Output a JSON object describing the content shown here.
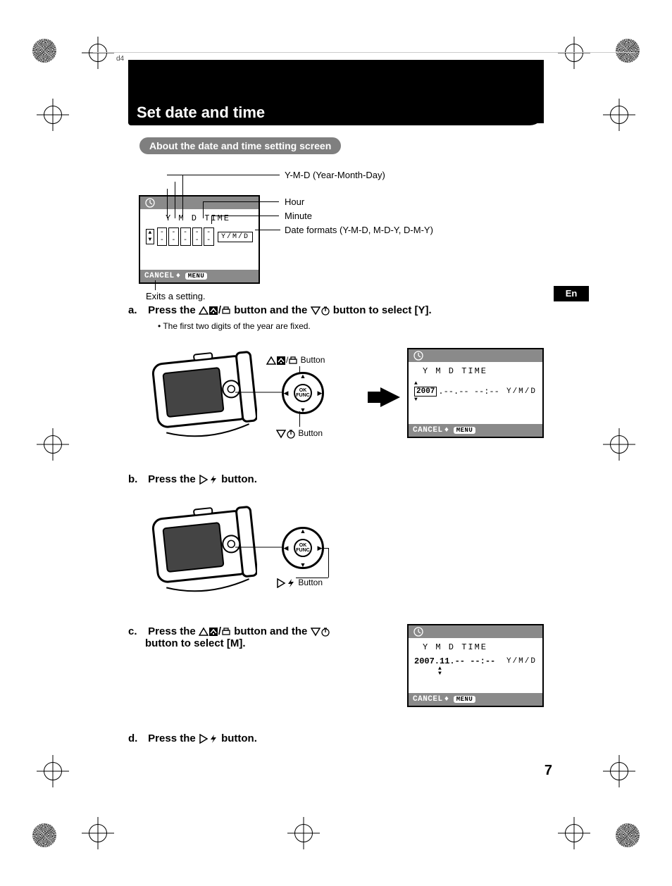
{
  "doc_id": "d4",
  "heading": "Set date and time",
  "subheading": "About the date and time setting screen",
  "en_label": "En",
  "callouts": {
    "ymd": "Y-M-D (Year-Month-Day)",
    "hour": "Hour",
    "minute": "Minute",
    "formats": "Date formats (Y-M-D, M-D-Y, D-M-Y)",
    "exits": "Exits a setting."
  },
  "screen_top": {
    "header": "Y  M  D  TIME",
    "fields": [
      "--",
      "--",
      "--",
      "--",
      "--"
    ],
    "ymd_box": "Y/M/D",
    "foot_cancel": "CANCEL",
    "foot_menu": "MENU"
  },
  "step_a": {
    "prefix": "a.",
    "text1": "Press the ",
    "text2": " button and the ",
    "text3": " button to select [Y].",
    "note": "The first two digits of the year are fixed.",
    "btn_up_label": " Button",
    "btn_down_label": " Button"
  },
  "screen_a": {
    "header": "Y  M  D  TIME",
    "year": "2007",
    "rest": ".--.--  --:--",
    "ymd": "Y/M/D",
    "foot_cancel": "CANCEL",
    "foot_menu": "MENU"
  },
  "step_b": {
    "prefix": "b.",
    "text1": "Press the ",
    "text2": " button.",
    "btn_right_label": " Button"
  },
  "step_c": {
    "prefix": "c.",
    "text1": "Press the ",
    "text2": " button and the ",
    "text3": " button to select [M]."
  },
  "screen_c": {
    "header": "Y  M  D  TIME",
    "line": "2007.11.--  --:--",
    "ymd": "Y/M/D",
    "foot_cancel": "CANCEL",
    "foot_menu": "MENU"
  },
  "step_d": {
    "prefix": "d.",
    "text1": "Press the ",
    "text2": " button."
  },
  "page_number": "7"
}
